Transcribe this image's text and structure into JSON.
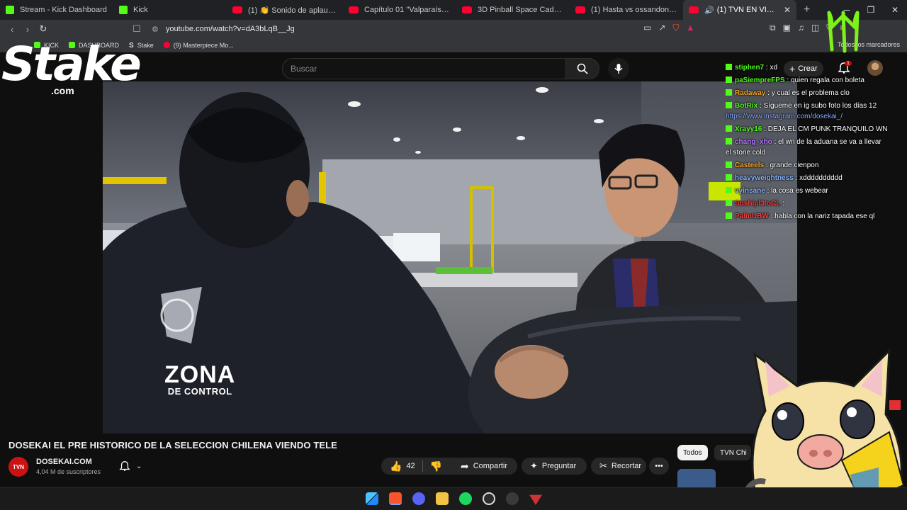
{
  "tabs": [
    {
      "title": "Stream - Kick Dashboard",
      "icon": "kick"
    },
    {
      "title": "Kick",
      "icon": "kick"
    },
    {
      "title": "(1) 👏 Sonido de aplausos y g",
      "icon": "youtube"
    },
    {
      "title": "Capítulo 01 \"Valparaíso\" | Chil",
      "icon": "youtube"
    },
    {
      "title": "3D Pinball Space Cadet [Origin",
      "icon": "youtube"
    },
    {
      "title": "(1) Hasta vs ossandon ebrios",
      "icon": "youtube"
    },
    {
      "title": "(1) TVN EN VIVO | ZON",
      "icon": "youtube",
      "active": true
    }
  ],
  "address": {
    "url": "youtube.com/watch?v=dA3bLqB__Jg"
  },
  "bookmarks": [
    {
      "label": "KICK",
      "icon": "kick"
    },
    {
      "label": "DASHBOARD",
      "icon": "kick"
    },
    {
      "label": "Stake",
      "icon": "stake"
    },
    {
      "label": "(9) Masterpiece Mo...",
      "icon": "youtube"
    }
  ],
  "bookmarks_all": "Todos los marcadores",
  "header": {
    "search_placeholder": "Buscar",
    "create_label": "Crear",
    "notif_count": "1"
  },
  "overlay": {
    "stake_logo": "Stake",
    "stake_com": ".com",
    "zona_main": "ZONA",
    "zona_sub": "DE CONTROL"
  },
  "chat": [
    {
      "user": "stiphen7",
      "text": "xd",
      "color": "#53fc18"
    },
    {
      "user": "paSiempreFPS",
      "text": "quien regala con boleta",
      "color": "#53fc18"
    },
    {
      "user": "Radaway",
      "text": "y cual es el problema clo",
      "color": "#f5a623"
    },
    {
      "user": "BotRix",
      "text": "Sígueme en ig subo foto los días 12",
      "link": "https://www.instagram.com/dosekai_/",
      "color": "#53fc18"
    },
    {
      "user": "Xrayy16",
      "text": "DEJA EL CM PUNK TRANQUILO WN",
      "color": "#53fc18"
    },
    {
      "user": "chang_xho",
      "text": "el wn de la aduana se va a llevar el stone cold",
      "color": "#b57bff"
    },
    {
      "user": "Casteels",
      "text": "grande cienpon",
      "color": "#f5a623"
    },
    {
      "user": "heavyweightness",
      "text": "xdddddddddd",
      "color": "#8ab4f8"
    },
    {
      "user": "vyinsane",
      "text": "la cosa es webear",
      "color": "#8ab4f8"
    },
    {
      "user": "Sushipl3toCL",
      "text": "",
      "color": "#ff3b3b"
    },
    {
      "user": "PalmUBW",
      "text": "habla con la nariz tapada ese ql",
      "color": "#ff3b3b"
    }
  ],
  "video": {
    "title": "DOSEKAI EL PRE HISTORICO DE LA SELECCION CHILENA VIENDO TELE",
    "channel": "DOSEKAI.COM",
    "channel_logo": "TVN",
    "subscribers": "4,04 M de suscriptores",
    "likes": "42",
    "share": "Compartir",
    "ask": "Preguntar",
    "clip": "Recortar"
  },
  "filters": [
    {
      "label": "Todos",
      "active": true
    },
    {
      "label": "TVN Chi",
      "active": false
    }
  ],
  "colors": {
    "kick": "#53fc18",
    "youtube": "#ff0033",
    "accent": "#cc0000"
  }
}
